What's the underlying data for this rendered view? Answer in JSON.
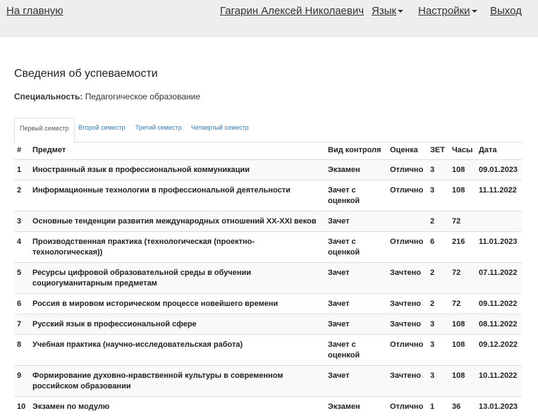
{
  "nav": {
    "home": "На главную",
    "user": "Гагарин Алексей Николаевич",
    "language": "Язык",
    "settings": "Настройки",
    "logout": "Выход"
  },
  "page": {
    "title": "Сведения об успеваемости",
    "specialty_label": "Специальность:",
    "specialty_value": "Педагогическое образование"
  },
  "tabs": [
    {
      "label": "Первый семестр",
      "active": true
    },
    {
      "label": "Второй семестр",
      "active": false
    },
    {
      "label": "Третий семестр",
      "active": false
    },
    {
      "label": "Четвертый семестр",
      "active": false
    }
  ],
  "table": {
    "headers": [
      "#",
      "Предмет",
      "Вид контроля",
      "Оценка",
      "ЗЕТ",
      "Часы",
      "Дата"
    ],
    "rows": [
      [
        "1",
        "Иностранный язык в профессиональной коммуникации",
        "Экзамен",
        "Отлично",
        "3",
        "108",
        "09.01.2023"
      ],
      [
        "2",
        "Информационные технологии в профессиональной деятельности",
        "Зачет с оценкой",
        "Отлично",
        "3",
        "108",
        "11.11.2022"
      ],
      [
        "3",
        "Основные тенденции развития международных отношений XX-XXI веков",
        "Зачет",
        "",
        "2",
        "72",
        ""
      ],
      [
        "4",
        "Производственная практика (технологическая (проектно-технологическая))",
        "Зачет с оценкой",
        "Отлично",
        "6",
        "216",
        "11.01.2023"
      ],
      [
        "5",
        "Ресурсы цифровой образовательной среды в обучении социогуманитарным предметам",
        "Зачет",
        "Зачтено",
        "2",
        "72",
        "07.11.2022"
      ],
      [
        "6",
        "Россия в мировом историческом процессе новейшего времени",
        "Зачет",
        "Зачтено",
        "2",
        "72",
        "09.11.2022"
      ],
      [
        "7",
        "Русский язык в профессиональной сфере",
        "Зачет",
        "Зачтено",
        "3",
        "108",
        "08.11.2022"
      ],
      [
        "8",
        "Учебная практика (научно-исследовательская работа)",
        "Зачет с оценкой",
        "Отлично",
        "3",
        "108",
        "09.12.2022"
      ],
      [
        "9",
        "Формирование духовно-нравственной культуры в современном российском образовании",
        "Зачет",
        "Зачтено",
        "3",
        "108",
        "10.11.2022"
      ],
      [
        "10",
        "Экзамен по модулю",
        "Экзамен",
        "Отлично",
        "1",
        "36",
        "13.01.2023"
      ]
    ]
  }
}
